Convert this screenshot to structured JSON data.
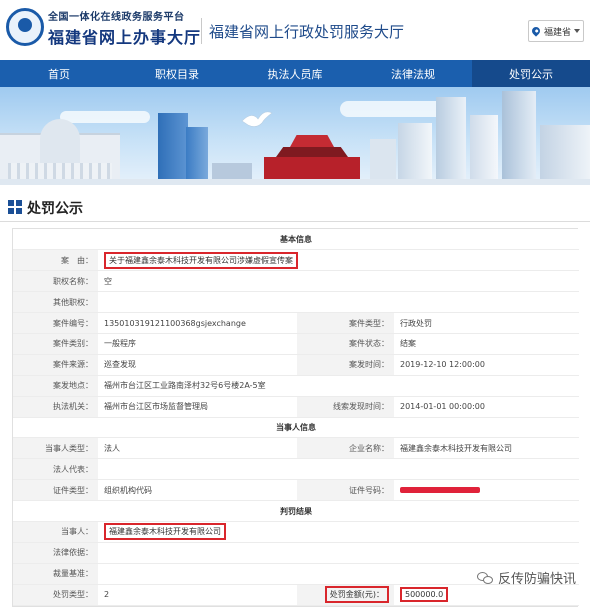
{
  "header": {
    "logo_sub": "全国一体化在线政务服务平台",
    "logo_main": "福建省网上办事大厅",
    "title": "福建省网上行政处罚服务大厅",
    "region": "福建省"
  },
  "nav": {
    "items": [
      {
        "label": "首页"
      },
      {
        "label": "职权目录"
      },
      {
        "label": "执法人员库"
      },
      {
        "label": "法律法规"
      },
      {
        "label": "处罚公示"
      }
    ],
    "active_index": 4
  },
  "page": {
    "title": "处罚公示"
  },
  "basic": {
    "heading": "基本信息",
    "case_label": "案　由：",
    "case_value": "关于福建鑫余泰木科技开发有限公司涉嫌虚假宣传案",
    "power_label": "职权名称：",
    "power_value": "空",
    "other_label": "其他职权：",
    "other_value": "",
    "case_no_label": "案件编号：",
    "case_no_value": "135010319121100368gsjexchange",
    "case_type_label": "案件类型：",
    "case_type_value": "行政处罚",
    "category_label": "案件类别：",
    "category_value": "一般程序",
    "status_label": "案件状态：",
    "status_value": "结案",
    "source_label": "案件来源：",
    "source_value": "巡查发现",
    "time_label": "案发时间：",
    "time_value": "2019-12-10 12:00:00",
    "place_label": "案发地点：",
    "place_value": "福州市台江区工业路南泽村32号6号楼2A-5室",
    "agency_label": "执法机关：",
    "agency_value": "福州市台江区市场监督管理局",
    "clue_label": "线索发现时间：",
    "clue_value": "2014-01-01 00:00:00"
  },
  "party": {
    "heading": "当事人信息",
    "type_label": "当事人类型：",
    "type_value": "法人",
    "company_label": "企业名称：",
    "company_value": "福建鑫余泰木科技开发有限公司",
    "rep_label": "法人代表：",
    "rep_value": "",
    "id_type_label": "证件类型：",
    "id_type_value": "组织机构代码",
    "id_no_label": "证件号码："
  },
  "result": {
    "heading": "判罚结果",
    "party_label": "当事人：",
    "party_value": "福建鑫余泰木科技开发有限公司",
    "law_label": "法律依据：",
    "law_value": "",
    "discretion_label": "裁量基准：",
    "discretion_value": "",
    "penalty_type_label": "处罚类型：",
    "penalty_type_value": "2",
    "amount_label": "处罚金额(元)：",
    "amount_value": "500000.0"
  },
  "watermark": "反传防骗快讯",
  "colors": {
    "nav": "#1b5fae",
    "highlight": "#d9262c",
    "brand": "#14387f"
  }
}
